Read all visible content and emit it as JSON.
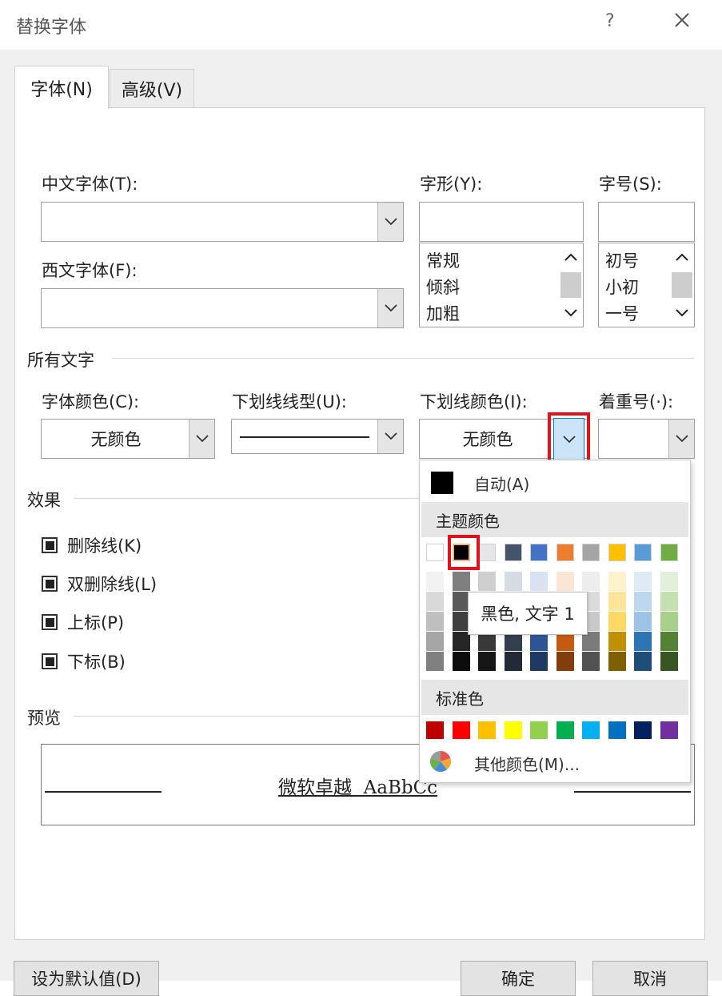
{
  "window": {
    "title": "替换字体",
    "help": "?",
    "close": "✕"
  },
  "tabs": [
    {
      "label": "字体(N)"
    },
    {
      "label": "高级(V)"
    }
  ],
  "font": {
    "chinese_label": "中文字体(T):",
    "western_label": "西文字体(F):",
    "style_label": "字形(Y):",
    "style_items": [
      "常规",
      "倾斜",
      "加粗"
    ],
    "size_label": "字号(S):",
    "size_items": [
      "初号",
      "小初",
      "一号"
    ]
  },
  "all_text": {
    "section": "所有文字",
    "font_color_label": "字体颜色(C):",
    "font_color_value": "无颜色",
    "underline_style_label": "下划线线型(U):",
    "underline_color_label": "下划线颜色(I):",
    "underline_color_value": "无颜色",
    "emphasis_label": "着重号(·):"
  },
  "effects": {
    "section": "效果",
    "items": [
      {
        "label": "删除线(K)"
      },
      {
        "label": "双删除线(L)"
      },
      {
        "label": "上标(P)"
      },
      {
        "label": "下标(B)"
      }
    ]
  },
  "preview": {
    "section": "预览",
    "text": "微软卓越  AaBbCc"
  },
  "popup": {
    "auto_label": "自动(A)",
    "theme_header": "主题颜色",
    "standard_header": "标准色",
    "more_label": "其他颜色(M)...",
    "tooltip": "黑色, 文字 1",
    "theme_colors": [
      "#ffffff",
      "#000000",
      "#e7e6e6",
      "#44546a",
      "#4472c4",
      "#ed7d31",
      "#a5a5a5",
      "#ffc000",
      "#5b9bd5",
      "#70ad47"
    ],
    "theme_shades": [
      [
        "#f2f2f2",
        "#d9d9d9",
        "#bfbfbf",
        "#a6a6a6",
        "#808080"
      ],
      [
        "#7f7f7f",
        "#595959",
        "#404040",
        "#262626",
        "#0d0d0d"
      ],
      [
        "#d0cece",
        "#aeabab",
        "#757171",
        "#3a3838",
        "#171616"
      ],
      [
        "#d6dce4",
        "#adb9ca",
        "#8496b0",
        "#323f4f",
        "#222a35"
      ],
      [
        "#d9e2f3",
        "#b4c6e7",
        "#8eaadb",
        "#2f5496",
        "#1f3864"
      ],
      [
        "#fbe5d5",
        "#f7cbac",
        "#f4b183",
        "#c55a11",
        "#833c0b"
      ],
      [
        "#ededed",
        "#dbdbdb",
        "#c9c9c9",
        "#7b7b7b",
        "#525252"
      ],
      [
        "#fff2cc",
        "#ffe599",
        "#ffd966",
        "#bf9000",
        "#7f6000"
      ],
      [
        "#deebf6",
        "#bdd7ee",
        "#9dc3e6",
        "#2e75b5",
        "#1f4e79"
      ],
      [
        "#e2efd9",
        "#c5e0b3",
        "#a8d08d",
        "#538135",
        "#375623"
      ]
    ],
    "standard_colors": [
      "#c00000",
      "#ff0000",
      "#ffc000",
      "#ffff00",
      "#92d050",
      "#00b050",
      "#00b0f0",
      "#0070c0",
      "#002060",
      "#7030a0"
    ]
  },
  "buttons": {
    "default": "设为默认值(D)",
    "ok": "确定",
    "cancel": "取消"
  }
}
